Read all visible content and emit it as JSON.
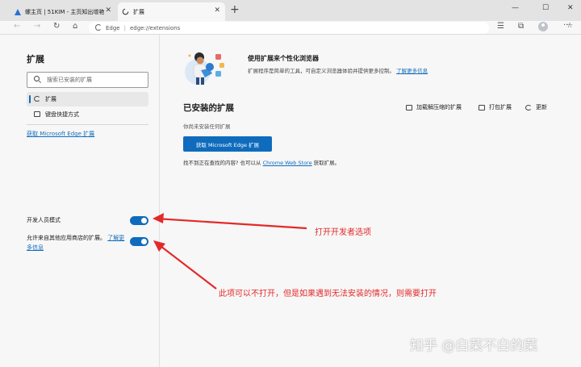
{
  "browser": {
    "tabs": [
      {
        "title": "螺主页 | 51KIM - 主页知出增艳"
      },
      {
        "title": "扩展"
      }
    ],
    "address": {
      "origin_label": "Edge",
      "url": "edge://extensions"
    }
  },
  "sidebar": {
    "title": "扩展",
    "search_placeholder": "搜索已安装的扩展",
    "items": [
      {
        "label": "扩展"
      },
      {
        "label": "键盘快捷方式"
      }
    ],
    "store_link": "获取 Microsoft Edge 扩展",
    "dev_mode_label": "开发人员模式",
    "other_stores_label": "允许来自其他应用商店的扩展。",
    "other_stores_link": "了解更多信息"
  },
  "main": {
    "hero_title": "使用扩展来个性化浏览器",
    "hero_desc": "扩展程序是简单的工具，可自定义浏览器体验并提供更多控制。",
    "hero_link": "了解更多信息",
    "installed_title": "已安装的扩展",
    "actions": [
      {
        "label": "加载解压缩的扩展"
      },
      {
        "label": "打包扩展"
      },
      {
        "label": "更新"
      }
    ],
    "none_installed": "你尚未安装任何扩展",
    "store_button": "获取 Microsoft Edge 扩展",
    "cant_find_prefix": "找不到正在查找的内容? 也可以从",
    "cant_find_link": "Chrome Web Store",
    "cant_find_suffix": "获取扩展。"
  },
  "annotations": {
    "dev_mode_note": "打开开发者选项",
    "other_stores_note": "此项可以不打开，但是如果遇到无法安装的情况，则需要打开"
  },
  "watermark": "知乎 @白菜不白的菜",
  "toggles": {
    "developer_mode": true,
    "other_stores": true
  },
  "colors": {
    "accent": "#0f6cbd",
    "annotation": "#e32a2a",
    "page_bg": "#f7f7f7"
  }
}
